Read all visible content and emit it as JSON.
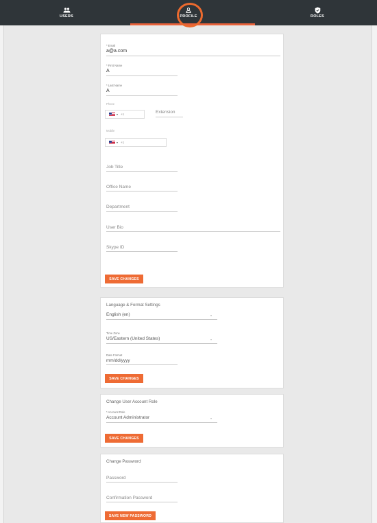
{
  "nav": {
    "users": "USERS",
    "profile": "PROFILE",
    "roles": "ROLES"
  },
  "profile": {
    "email_label": "* Email",
    "email_value": "a@a.com",
    "first_name_label": "* First Name",
    "first_name_value": "A",
    "last_name_label": "* Last Name",
    "last_name_value": "A",
    "phone_label": "Phone",
    "phone_code": "+1",
    "extension_placeholder": "Extension",
    "mobile_label": "Mobile",
    "mobile_code": "+1",
    "job_title_placeholder": "Job Title",
    "office_name_placeholder": "Office Name",
    "department_placeholder": "Department",
    "user_bio_placeholder": "User Bio",
    "skype_id_placeholder": "Skype ID",
    "save_label": "SAVE CHANGES"
  },
  "language": {
    "heading": "Language & Format Settings",
    "language_value": "English (en)",
    "time_zone_label": "Time Zone",
    "time_zone_value": "US/Eastern (United States)",
    "date_format_label": "Date Format",
    "date_format_value": "mm/dd/yyyy",
    "save_label": "SAVE CHANGES"
  },
  "role": {
    "heading": "Change User Account Role",
    "account_role_label": "* Account Role",
    "account_role_value": "Account Administrator",
    "save_label": "SAVE CHANGES"
  },
  "password": {
    "heading": "Change Password",
    "password_placeholder": "Password",
    "confirmation_placeholder": "Confirmation Password",
    "save_label": "SAVE NEW PASSWORD"
  },
  "colors": {
    "accent": "#ee6b34",
    "topbar": "#2f3539",
    "highlight": "#ec6a2e"
  },
  "icons": {
    "users": "users-icon",
    "profile": "person-icon",
    "roles": "shield-icon",
    "flag": "us-flag-icon",
    "caret": "chevron-down-icon"
  }
}
